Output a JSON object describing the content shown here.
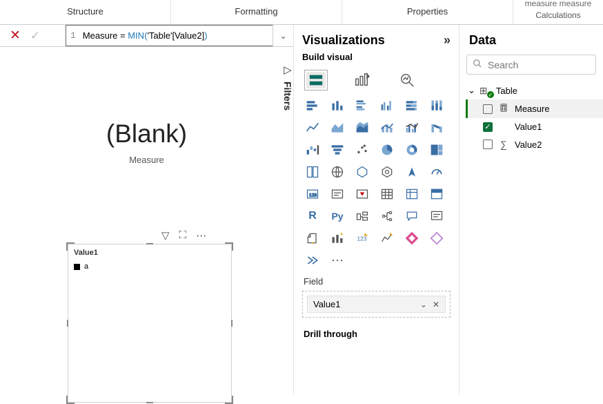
{
  "ribbon": {
    "tabs": [
      "Structure",
      "Formatting",
      "Properties"
    ],
    "calc_top": "measure measure",
    "calc_bottom": "Calculations"
  },
  "formula": {
    "line_no": "1",
    "prefix": "Measure = ",
    "fn": "MIN",
    "arg": "'Table'[Value2]"
  },
  "filters_label": "Filters",
  "card": {
    "title": "(Blank)",
    "subtitle": "Measure"
  },
  "visual": {
    "header": "Value1",
    "row_label": "a"
  },
  "viz": {
    "title": "Visualizations",
    "subtitle": "Build visual",
    "field_header": "Field",
    "field_value": "Value1",
    "drill": "Drill through"
  },
  "data": {
    "title": "Data",
    "search_placeholder": "Search",
    "table_name": "Table",
    "fields": [
      {
        "name": "Measure",
        "icon": "calculator",
        "checked": false,
        "selected": true
      },
      {
        "name": "Value1",
        "icon": "none",
        "checked": true,
        "selected": false
      },
      {
        "name": "Value2",
        "icon": "sigma",
        "checked": false,
        "selected": false
      }
    ]
  }
}
